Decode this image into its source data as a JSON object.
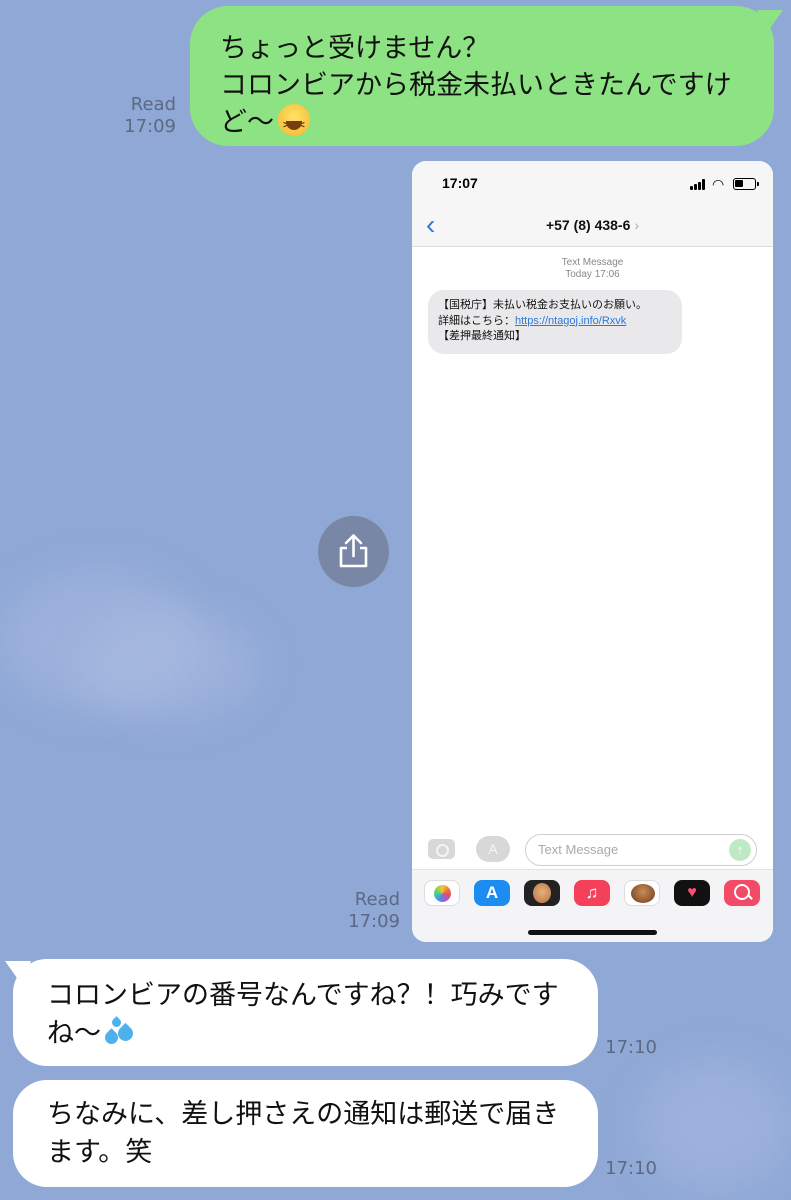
{
  "outgoing": {
    "lines": [
      "ちょっと受けません？",
      "コロンビアから税金未払いときたんですけ",
      "ど〜"
    ],
    "emoji": "grinning-squinting-face",
    "read_label": "Read",
    "time": "17:09"
  },
  "screenshot": {
    "status_time": "17:07",
    "contact": "+57 (8) 438-6",
    "contact_chevron": "›",
    "back_glyph": "‹",
    "thread_label": "Text Message",
    "thread_date": "Today 17:06",
    "sms": {
      "line1": "【国税庁】未払い税金お支払いのお願い。",
      "line2_prefix": "詳細はこちら：",
      "link": "https://ntagoj.info/Rxvk",
      "line3": "【差押最終通知】"
    },
    "input_placeholder": "Text Message",
    "send_glyph": "↑",
    "apps_glyph": "A",
    "tray": [
      "photos-icon",
      "app-store-icon",
      "memoji-icon",
      "music-icon",
      "memoji-stickers-icon",
      "heart-digital-touch-icon",
      "web-search-icon"
    ],
    "tray_glyphs": {
      "app_store": "A",
      "music": "♫",
      "heart": "♥"
    }
  },
  "screenshot_read": {
    "label": "Read",
    "time": "17:09"
  },
  "incoming": [
    {
      "lines": [
        "コロンビアの番号なんですね？！巧みです",
        "ね〜"
      ],
      "emoji": "sweat-droplets",
      "time": "17:10"
    },
    {
      "lines": [
        "ちなみに、差し押さえの通知は郵送で届き",
        "ます。笑"
      ],
      "time": "17:10"
    }
  ],
  "colors": {
    "background": "#8fa8d6",
    "outgoing_bubble": "#8de384",
    "incoming_bubble": "#ffffff",
    "link": "#2d7ad6"
  }
}
